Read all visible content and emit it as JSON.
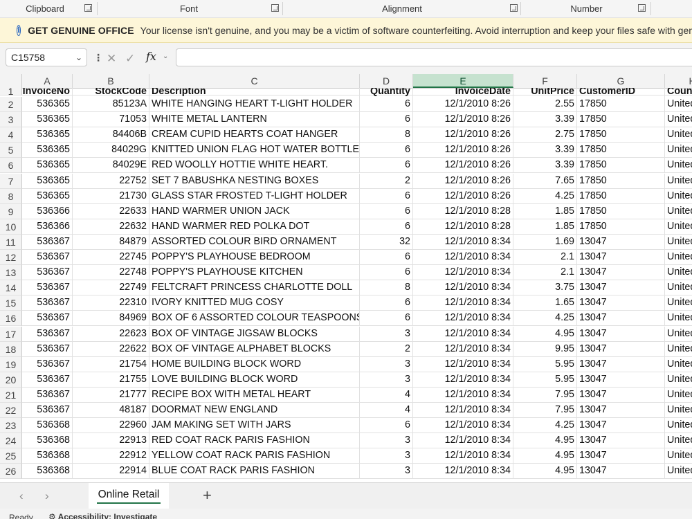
{
  "ribbon_groups": [
    {
      "label": "Clipboard"
    },
    {
      "label": "Font"
    },
    {
      "label": "Alignment"
    },
    {
      "label": "Number"
    }
  ],
  "license_bar": {
    "title": "GET GENUINE OFFICE",
    "message": "Your license isn't genuine, and you may be a victim of software counterfeiting. Avoid interruption and keep your files safe with genuine Office today."
  },
  "formula_bar": {
    "name_box": "C15758",
    "formula": ""
  },
  "columns": [
    "A",
    "B",
    "C",
    "D",
    "E",
    "F",
    "G",
    "H"
  ],
  "header_row": {
    "row": "1",
    "cells": [
      "InvoiceNo",
      "StockCode",
      "Description",
      "Quantity",
      "InvoiceDate",
      "UnitPrice",
      "CustomerID",
      "Country"
    ]
  },
  "rows": [
    {
      "row": "2",
      "cells": [
        "536365",
        "85123A",
        "WHITE HANGING HEART T-LIGHT HOLDER",
        "6",
        "12/1/2010 8:26",
        "2.55",
        "17850",
        "United Kingdom"
      ]
    },
    {
      "row": "3",
      "cells": [
        "536365",
        "71053",
        "WHITE METAL LANTERN",
        "6",
        "12/1/2010 8:26",
        "3.39",
        "17850",
        "United Kingdom"
      ]
    },
    {
      "row": "4",
      "cells": [
        "536365",
        "84406B",
        "CREAM CUPID HEARTS COAT HANGER",
        "8",
        "12/1/2010 8:26",
        "2.75",
        "17850",
        "United Kingdom"
      ]
    },
    {
      "row": "5",
      "cells": [
        "536365",
        "84029G",
        "KNITTED UNION FLAG HOT WATER BOTTLE",
        "6",
        "12/1/2010 8:26",
        "3.39",
        "17850",
        "United Kingdom"
      ]
    },
    {
      "row": "6",
      "cells": [
        "536365",
        "84029E",
        "RED WOOLLY HOTTIE WHITE HEART.",
        "6",
        "12/1/2010 8:26",
        "3.39",
        "17850",
        "United Kingdom"
      ]
    },
    {
      "row": "7",
      "cells": [
        "536365",
        "22752",
        "SET 7 BABUSHKA NESTING BOXES",
        "2",
        "12/1/2010 8:26",
        "7.65",
        "17850",
        "United Kingdom"
      ]
    },
    {
      "row": "8",
      "cells": [
        "536365",
        "21730",
        "GLASS STAR FROSTED T-LIGHT HOLDER",
        "6",
        "12/1/2010 8:26",
        "4.25",
        "17850",
        "United Kingdom"
      ]
    },
    {
      "row": "9",
      "cells": [
        "536366",
        "22633",
        "HAND WARMER UNION JACK",
        "6",
        "12/1/2010 8:28",
        "1.85",
        "17850",
        "United Kingdom"
      ]
    },
    {
      "row": "10",
      "cells": [
        "536366",
        "22632",
        "HAND WARMER RED POLKA DOT",
        "6",
        "12/1/2010 8:28",
        "1.85",
        "17850",
        "United Kingdom"
      ]
    },
    {
      "row": "11",
      "cells": [
        "536367",
        "84879",
        "ASSORTED COLOUR BIRD ORNAMENT",
        "32",
        "12/1/2010 8:34",
        "1.69",
        "13047",
        "United Kingdom"
      ]
    },
    {
      "row": "12",
      "cells": [
        "536367",
        "22745",
        "POPPY'S PLAYHOUSE BEDROOM",
        "6",
        "12/1/2010 8:34",
        "2.1",
        "13047",
        "United Kingdom"
      ]
    },
    {
      "row": "13",
      "cells": [
        "536367",
        "22748",
        "POPPY'S PLAYHOUSE KITCHEN",
        "6",
        "12/1/2010 8:34",
        "2.1",
        "13047",
        "United Kingdom"
      ]
    },
    {
      "row": "14",
      "cells": [
        "536367",
        "22749",
        "FELTCRAFT PRINCESS CHARLOTTE DOLL",
        "8",
        "12/1/2010 8:34",
        "3.75",
        "13047",
        "United Kingdom"
      ]
    },
    {
      "row": "15",
      "cells": [
        "536367",
        "22310",
        "IVORY KNITTED MUG COSY",
        "6",
        "12/1/2010 8:34",
        "1.65",
        "13047",
        "United Kingdom"
      ]
    },
    {
      "row": "16",
      "cells": [
        "536367",
        "84969",
        "BOX OF 6 ASSORTED COLOUR TEASPOONS",
        "6",
        "12/1/2010 8:34",
        "4.25",
        "13047",
        "United Kingdom"
      ]
    },
    {
      "row": "17",
      "cells": [
        "536367",
        "22623",
        "BOX OF VINTAGE JIGSAW BLOCKS",
        "3",
        "12/1/2010 8:34",
        "4.95",
        "13047",
        "United Kingdom"
      ]
    },
    {
      "row": "18",
      "cells": [
        "536367",
        "22622",
        "BOX OF VINTAGE ALPHABET BLOCKS",
        "2",
        "12/1/2010 8:34",
        "9.95",
        "13047",
        "United Kingdom"
      ]
    },
    {
      "row": "19",
      "cells": [
        "536367",
        "21754",
        "HOME BUILDING BLOCK WORD",
        "3",
        "12/1/2010 8:34",
        "5.95",
        "13047",
        "United Kingdom"
      ]
    },
    {
      "row": "20",
      "cells": [
        "536367",
        "21755",
        "LOVE BUILDING BLOCK WORD",
        "3",
        "12/1/2010 8:34",
        "5.95",
        "13047",
        "United Kingdom"
      ]
    },
    {
      "row": "21",
      "cells": [
        "536367",
        "21777",
        "RECIPE BOX WITH METAL HEART",
        "4",
        "12/1/2010 8:34",
        "7.95",
        "13047",
        "United Kingdom"
      ]
    },
    {
      "row": "22",
      "cells": [
        "536367",
        "48187",
        "DOORMAT NEW ENGLAND",
        "4",
        "12/1/2010 8:34",
        "7.95",
        "13047",
        "United Kingdom"
      ]
    },
    {
      "row": "23",
      "cells": [
        "536368",
        "22960",
        "JAM MAKING SET WITH JARS",
        "6",
        "12/1/2010 8:34",
        "4.25",
        "13047",
        "United Kingdom"
      ]
    },
    {
      "row": "24",
      "cells": [
        "536368",
        "22913",
        "RED COAT RACK PARIS FASHION",
        "3",
        "12/1/2010 8:34",
        "4.95",
        "13047",
        "United Kingdom"
      ]
    },
    {
      "row": "25",
      "cells": [
        "536368",
        "22912",
        "YELLOW COAT RACK PARIS FASHION",
        "3",
        "12/1/2010 8:34",
        "4.95",
        "13047",
        "United Kingdom"
      ]
    },
    {
      "row": "26",
      "cells": [
        "536368",
        "22914",
        "BLUE COAT RACK PARIS FASHION",
        "3",
        "12/1/2010 8:34",
        "4.95",
        "13047",
        "United Kingdom"
      ]
    }
  ],
  "sheet_tabs": [
    {
      "label": "Online Retail",
      "active": true
    }
  ],
  "status_bar": {
    "ready": "Ready",
    "accessibility": "Accessibility: Investigate"
  },
  "colors": {
    "accent": "#217346",
    "selected_header": "#c6e2cf",
    "license_bar": "#fdf6d8",
    "info_icon": "#1f5fbf"
  }
}
